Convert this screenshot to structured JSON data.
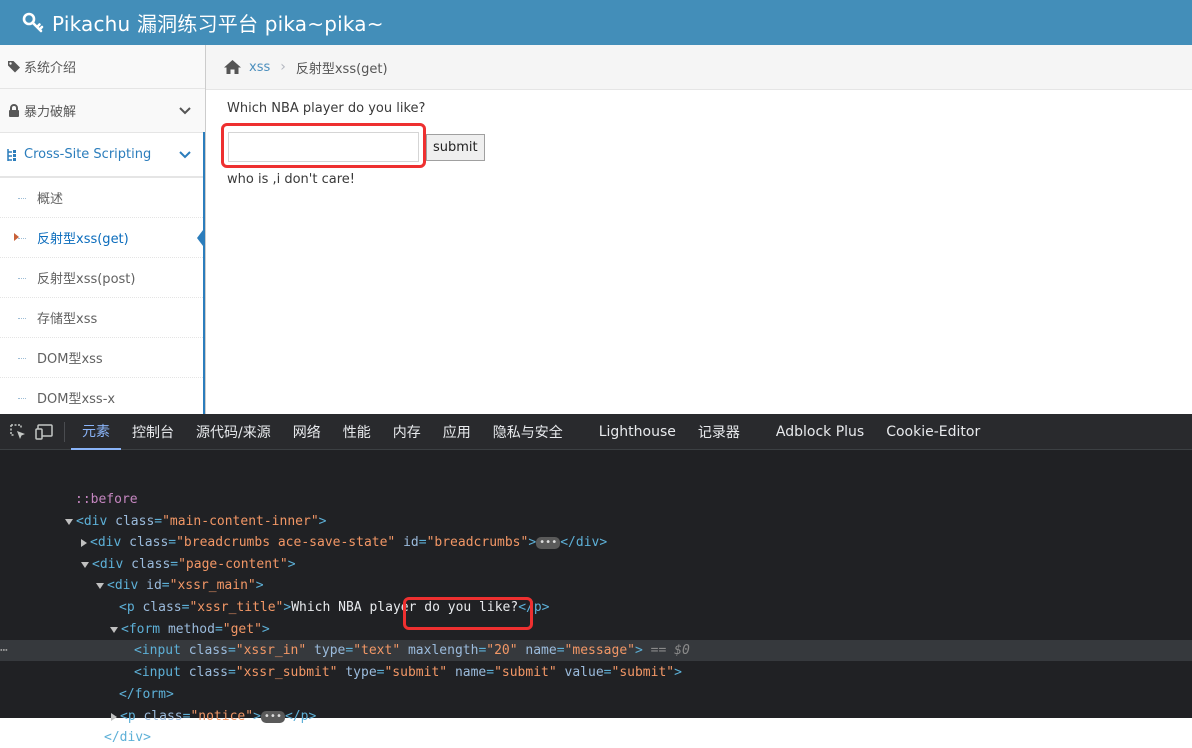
{
  "header": {
    "title": "Pikachu 漏洞练习平台 pika~pika~"
  },
  "sidebar": {
    "items": [
      {
        "label": "系统介绍"
      },
      {
        "label": "暴力破解"
      },
      {
        "label": "Cross-Site Scripting"
      }
    ],
    "submenu": [
      {
        "label": "概述"
      },
      {
        "label": "反射型xss(get)"
      },
      {
        "label": "反射型xss(post)"
      },
      {
        "label": "存储型xss"
      },
      {
        "label": "DOM型xss"
      },
      {
        "label": "DOM型xss-x"
      }
    ]
  },
  "breadcrumbs": {
    "link": "xss",
    "current": "反射型xss(get)"
  },
  "content": {
    "title": "Which NBA player do you like?",
    "input_value": "",
    "submit_label": "submit",
    "notice": "who is ,i don't care!"
  },
  "devtools": {
    "tabs": [
      "元素",
      "控制台",
      "源代码/来源",
      "网络",
      "性能",
      "内存",
      "应用",
      "隐私与安全",
      "Lighthouse",
      "记录器",
      "Adblock Plus",
      "Cookie-Editor"
    ],
    "dom": {
      "before": "::before",
      "l1_tag": "div",
      "l1_attr": "class",
      "l1_val": "\"main-content-inner\"",
      "l2_attr1": "class",
      "l2_val1": "\"breadcrumbs ace-save-state\"",
      "l2_attr2": "id",
      "l2_val2": "\"breadcrumbs\"",
      "l3_val": "\"page-content\"",
      "l4_attr": "id",
      "l4_val": "\"xssr_main\"",
      "l5_val": "\"xssr_title\"",
      "l5_text": "Which NBA player do you like?",
      "l6_attr": "method",
      "l6_val": "\"get\"",
      "l7_cls": "\"xssr_in\"",
      "l7_type": "\"text\"",
      "l7_max": "\"20\"",
      "l7_name": "\"message\"",
      "l7_eq": "== $0",
      "l8_cls": "\"xssr_submit\"",
      "l8_type": "\"submit\"",
      "l8_name": "\"submit\"",
      "l8_value": "\"submit\"",
      "l10_val": "\"notice\"",
      "dots": "⋯"
    }
  }
}
